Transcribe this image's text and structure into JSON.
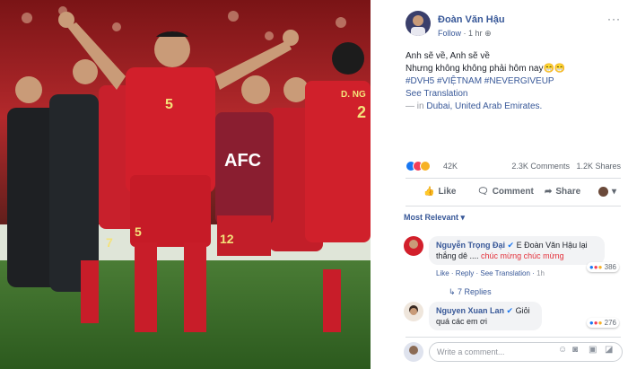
{
  "post": {
    "author": "Đoàn Văn Hậu",
    "follow": "Follow",
    "time": "1 hr",
    "caption_line1": "Anh sẽ về, Anh sẽ về",
    "caption_line2": "Nhưng không không phải hôm nay😁😁",
    "hashtags": "#DVH5 #VIỆTNAM #NEVERGIVEUP",
    "see_translation": "See Translation",
    "location_prefix": "— in",
    "location": "Dubai, United Arab Emirates."
  },
  "photo": {
    "board_text": "AFC",
    "jersey_5a": "5",
    "jersey_5b": "5",
    "jersey_12": "12",
    "jersey_7": "7",
    "jersey_name_right": "D. NG",
    "jersey_num_right": "2"
  },
  "reactions": {
    "count": "42K",
    "comments": "2.3K Comments",
    "shares": "1.2K Shares"
  },
  "actions": {
    "like": "Like",
    "comment": "Comment",
    "share": "Share"
  },
  "filter": "Most Relevant",
  "comments": [
    {
      "name": "Nguyễn Trọng Đại",
      "text_a": "E Đoàn Văn Hậu lại",
      "text_b": "thắng dê .... ",
      "text_c": "chúc mừng chúc mừng",
      "like": "Like",
      "reply": "Reply",
      "see_translation": "See Translation",
      "time": "1h",
      "reactions": "386",
      "replies": "7 Replies"
    },
    {
      "name": "Nguyen Xuan Lan",
      "text_a": "Giỏi quá",
      "text_b": "các em ơi",
      "reactions": "276"
    }
  ],
  "write_placeholder": "Write a comment...",
  "colors": {
    "link": "#385898",
    "jersey_red": "#d21f2b",
    "pitch_green": "#3a6b2a"
  }
}
